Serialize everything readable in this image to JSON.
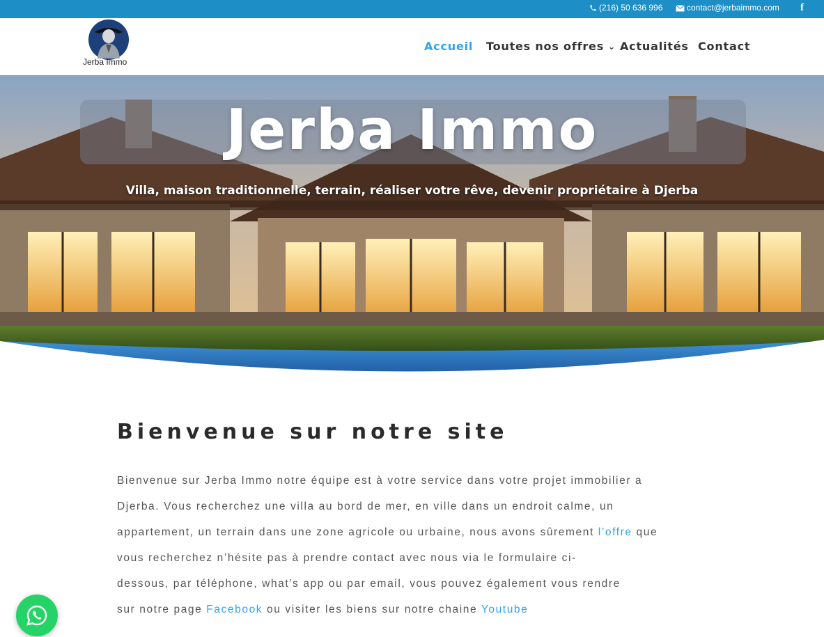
{
  "topbar": {
    "phone": "(216) 50 636 996",
    "email": "contact@jerbaimmo.com",
    "facebook_glyph": "f",
    "color": "#1e8fc6"
  },
  "header": {
    "logo_text": "Jerba Immo",
    "nav": [
      {
        "label": "Accueil",
        "active": true
      },
      {
        "label": "Toutes nos offres",
        "has_dropdown": true
      },
      {
        "label": "Actualités"
      },
      {
        "label": "Contact"
      }
    ],
    "active_color": "#2ea3f2"
  },
  "hero": {
    "title": "Jerba Immo",
    "subtitle": "Villa, maison traditionnelle, terrain, réaliser votre rêve, devenir propriétaire à Djerba"
  },
  "content": {
    "title": "Bienvenue sur notre site",
    "lines": [
      {
        "before": "Bienvenue sur Jerba Immo notre équipe est à votre service dans votre projet immobilier a"
      },
      {
        "before": "Djerba. Vous recherchez une villa au bord de mer, en ville dans un endroit calme, un"
      },
      {
        "before": "appartement, un terrain dans une zone agricole ou urbaine, nous avons sûrement ",
        "link": "l’offre",
        "after": " que"
      },
      {
        "before": "vous recherchez n’hésite pas à prendre contact avec nous via le formulaire ci-"
      },
      {
        "before": "dessous, par téléphone, what’s app ou par email, vous pouvez également vous rendre"
      },
      {
        "before": "sur notre page ",
        "link": "Facebook",
        "after": " ou visiter les biens sur notre chaine ",
        "link2": "Youtube"
      }
    ]
  },
  "whatsapp": {
    "icon": "whatsapp-icon",
    "color": "#25d366"
  }
}
